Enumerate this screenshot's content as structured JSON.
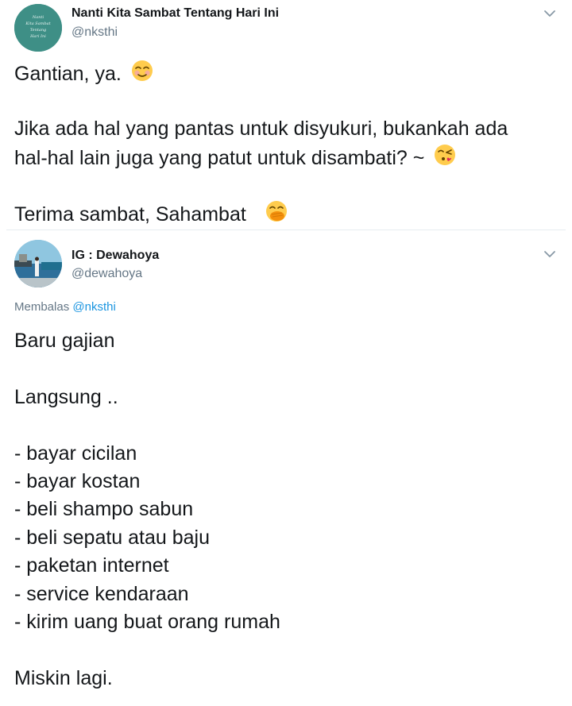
{
  "tweets": [
    {
      "display_name": "Nanti Kita Sambat Tentang Hari Ini",
      "handle": "@nksthi",
      "avatar_text": "Nanti Kita Sambat Tentang Hari Ini",
      "lines": [
        "Gantian, ya.",
        "",
        "Jika ada hal yang pantas untuk disyukuri, bukankah ada",
        "hal-hal lain juga yang patut untuk disambati? ~",
        "",
        "Terima sambat, Sahambat"
      ]
    },
    {
      "display_name": "IG : Dewahoya",
      "handle": "@dewahoya",
      "reply_prefix": "Membalas",
      "reply_to": "@nksthi",
      "lines": [
        "Baru gajian",
        "",
        "Langsung ..",
        "",
        "- bayar cicilan",
        "- bayar kostan",
        "- beli shampo sabun",
        "- beli sepatu atau baju",
        "- paketan internet",
        "- service kendaraan",
        "- kirim uang buat orang rumah",
        "",
        "Miskin lagi."
      ]
    }
  ],
  "icons": {
    "caret": "chevron-down-icon",
    "emoji_1": "smiling-face-with-smiling-eyes-emoji",
    "emoji_2": "face-blowing-a-kiss-emoji",
    "emoji_3": "face-with-hand-over-mouth-emoji"
  },
  "colors": {
    "text": "#14171a",
    "secondary": "#657786",
    "link": "#1b95e0",
    "avatar_1_bg": "#3e8f86"
  }
}
